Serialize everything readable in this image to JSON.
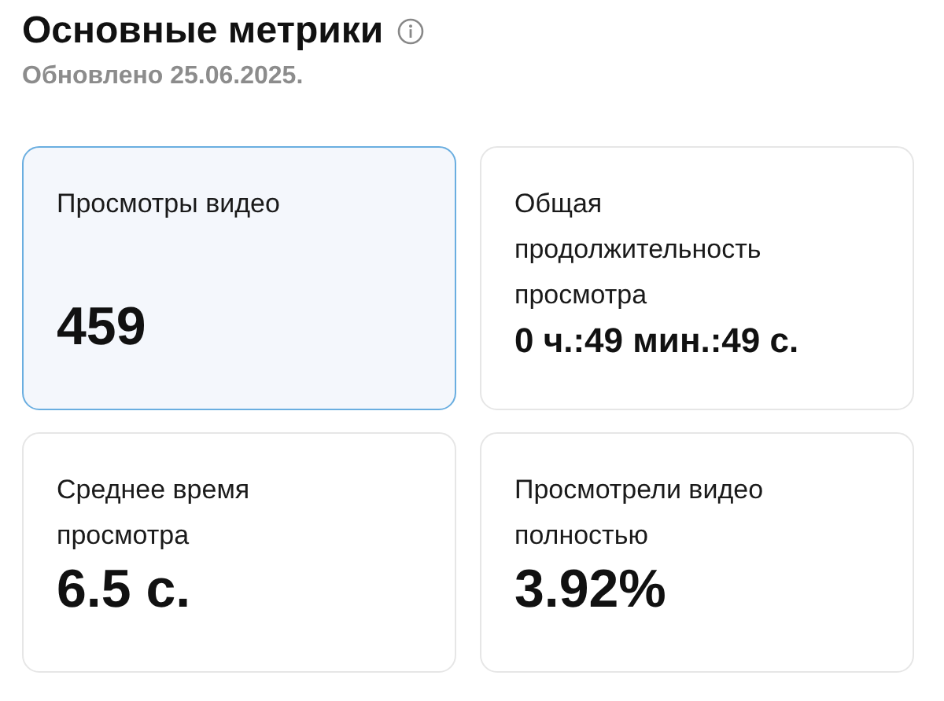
{
  "header": {
    "title": "Основные метрики",
    "updated": "Обновлено 25.06.2025."
  },
  "metrics": [
    {
      "label": "Просмотры видео",
      "value": "459",
      "kind": "large",
      "selected": true
    },
    {
      "label": "Общая продолжительность просмотра",
      "value": "0 ч.:49 мин.:49 с.",
      "kind": "medium",
      "selected": false
    },
    {
      "label": "Среднее время просмотра",
      "value": "6.5 с.",
      "kind": "large",
      "selected": false
    },
    {
      "label": "Просмотрели видео полностью",
      "value": "3.92%",
      "kind": "large",
      "selected": false
    }
  ]
}
